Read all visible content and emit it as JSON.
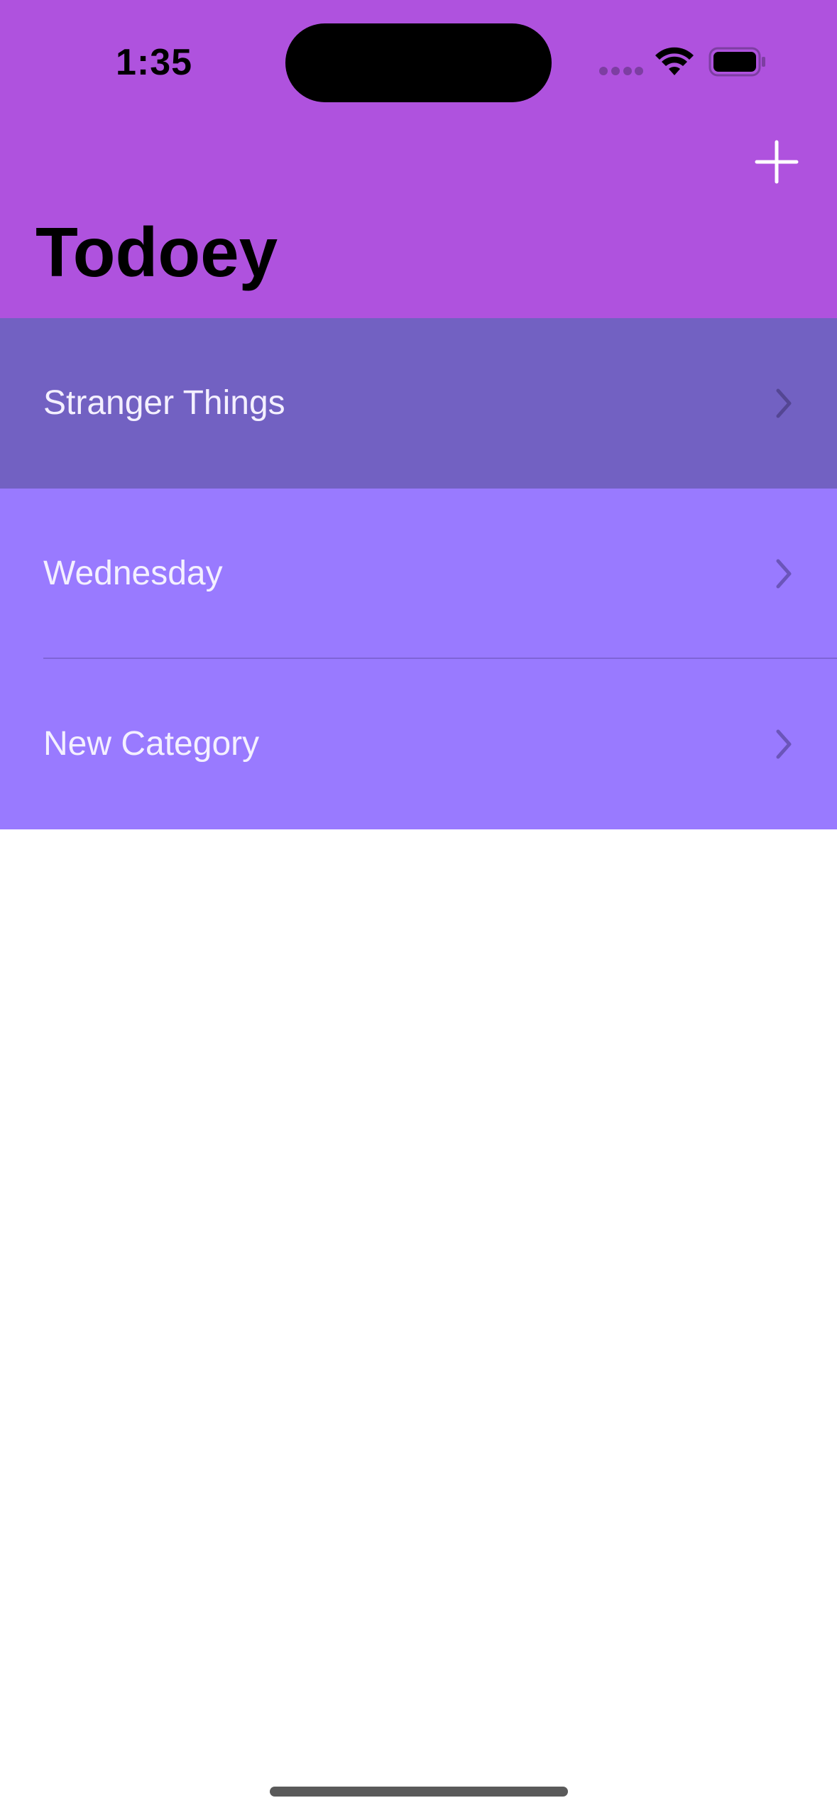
{
  "status_bar": {
    "time": "1:35"
  },
  "nav": {
    "title": "Todoey",
    "add_icon": "plus-icon"
  },
  "categories": [
    {
      "label": "Stranger Things",
      "color": "#7261c2",
      "icon": "chevron-right-icon"
    },
    {
      "label": "Wednesday",
      "color": "#997aff",
      "icon": "chevron-right-icon"
    },
    {
      "label": "New Category",
      "color": "#997aff",
      "icon": "chevron-right-icon"
    }
  ],
  "colors": {
    "header_background": "#af52de",
    "page_background": "#ffffff",
    "row_text": "#f4f0ff"
  }
}
